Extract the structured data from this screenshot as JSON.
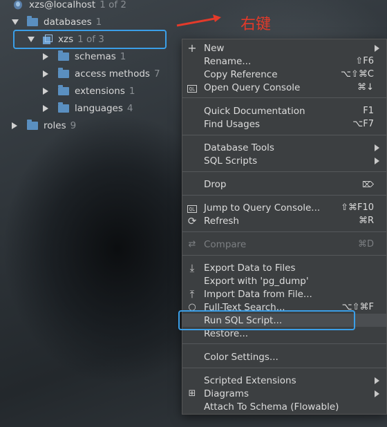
{
  "tree": {
    "host": {
      "label": "xzs@localhost",
      "count": "1 of 2"
    },
    "databases": {
      "label": "databases",
      "count": "1"
    },
    "xzs": {
      "label": "xzs",
      "count": "1 of 3"
    },
    "children": [
      {
        "label": "schemas",
        "count": "1"
      },
      {
        "label": "access methods",
        "count": "7"
      },
      {
        "label": "extensions",
        "count": "1"
      },
      {
        "label": "languages",
        "count": "4"
      }
    ],
    "roles": {
      "label": "roles",
      "count": "9"
    }
  },
  "annotation": {
    "text": "右键",
    "color": "#e33a2a"
  },
  "highlight_color": "#3b9fe8",
  "menu": {
    "new": {
      "label": "New"
    },
    "rename": {
      "label": "Rename...",
      "shortcut": "⇧F6"
    },
    "copy_reference": {
      "label": "Copy Reference",
      "shortcut": "⌥⇧⌘C"
    },
    "open_query_console": {
      "label": "Open Query Console",
      "shortcut": "⌘↓",
      "icon": "QL"
    },
    "quick_documentation": {
      "label": "Quick Documentation",
      "shortcut": "F1"
    },
    "find_usages": {
      "label": "Find Usages",
      "shortcut": "⌥F7"
    },
    "database_tools": {
      "label": "Database Tools"
    },
    "sql_scripts": {
      "label": "SQL Scripts"
    },
    "drop": {
      "label": "Drop"
    },
    "jump_to_query_console": {
      "label": "Jump to Query Console...",
      "shortcut": "⇧⌘F10",
      "icon": "QL"
    },
    "refresh": {
      "label": "Refresh",
      "shortcut": "⌘R"
    },
    "compare": {
      "label": "Compare",
      "shortcut": "⌘D"
    },
    "export_data": {
      "label": "Export Data to Files"
    },
    "export_pg_dump": {
      "label": "Export with 'pg_dump'"
    },
    "import_data": {
      "label": "Import Data from File..."
    },
    "full_text_search": {
      "label": "Full-Text Search...",
      "shortcut": "⌥⇧⌘F"
    },
    "run_sql_script": {
      "label": "Run SQL Script..."
    },
    "restore": {
      "label": "Restore..."
    },
    "color_settings": {
      "label": "Color Settings..."
    },
    "scripted_extensions": {
      "label": "Scripted Extensions"
    },
    "diagrams": {
      "label": "Diagrams"
    },
    "attach_to_schema": {
      "label": "Attach To Schema (Flowable)"
    }
  }
}
